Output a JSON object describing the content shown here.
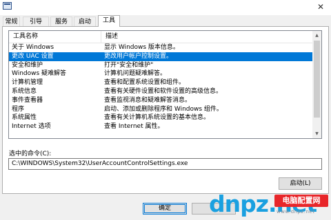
{
  "window": {
    "close_glyph": "✕",
    "icon": "system-config-icon"
  },
  "tabs": [
    {
      "label": "常规"
    },
    {
      "label": "引导"
    },
    {
      "label": "服务"
    },
    {
      "label": "启动"
    },
    {
      "label": "工具",
      "active": true
    }
  ],
  "tools_list": {
    "headers": {
      "name": "工具名称",
      "description": "描述"
    },
    "rows": [
      {
        "name": "关于 Windows",
        "description": "显示 Windows 版本信息。"
      },
      {
        "name": "更改 UAC 设置",
        "description": "更改用户帐户控制设置。",
        "selected": true
      },
      {
        "name": "安全和维护",
        "description": "打开\"安全和维护\""
      },
      {
        "name": "Windows 疑难解答",
        "description": "计算机问题疑难解答。"
      },
      {
        "name": "计算机管理",
        "description": "查看和配置系统设置和组件。"
      },
      {
        "name": "系统信息",
        "description": "查看有关硬件设置和软件设置的高级信息。"
      },
      {
        "name": "事件查看器",
        "description": "查看监视消息和疑难解答消息。"
      },
      {
        "name": "程序",
        "description": "启动、添加或删除程序和 Windows 组件。"
      },
      {
        "name": "系统属性",
        "description": "查看有关计算机系统设置的基本信息。"
      },
      {
        "name": "Internet 选项",
        "description": "查看 Internet 属性。"
      }
    ],
    "scroll_up_glyph": "▲",
    "scroll_down_glyph": "▼"
  },
  "command": {
    "label": "选中的命令(C):",
    "value": "C:\\WINDOWS\\System32\\UserAccountControlSettings.exe"
  },
  "buttons": {
    "launch": "启动(L)",
    "ok": "确定"
  },
  "watermark": {
    "logo": "dnpz.net",
    "badge": "电脑配置网",
    "url": "www.dnpz.net"
  },
  "colors": {
    "selection": "#0078d7",
    "watermark_blue": "#1aa0e0",
    "watermark_red": "#e8262a"
  }
}
